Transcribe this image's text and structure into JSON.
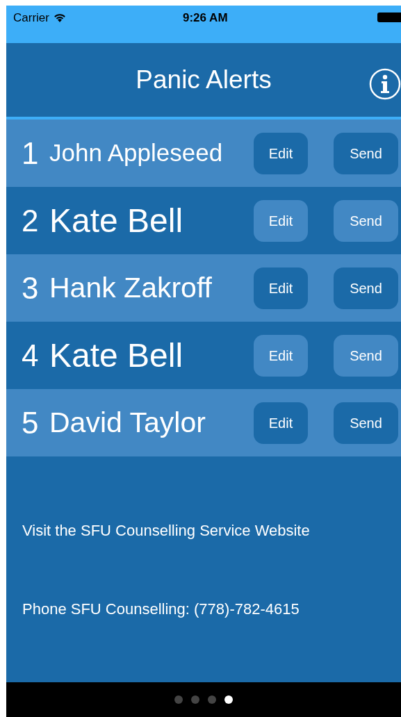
{
  "status_bar": {
    "carrier": "Carrier",
    "time": "9:26 AM"
  },
  "nav_bar": {
    "title": "Panic Alerts"
  },
  "contacts": [
    {
      "number": "1",
      "name": "John Appleseed",
      "edit": "Edit",
      "send": "Send"
    },
    {
      "number": "2",
      "name": "Kate Bell",
      "edit": "Edit",
      "send": "Send"
    },
    {
      "number": "3",
      "name": "Hank Zakroff",
      "edit": "Edit",
      "send": "Send"
    },
    {
      "number": "4",
      "name": "Kate Bell",
      "edit": "Edit",
      "send": "Send"
    },
    {
      "number": "5",
      "name": "David Taylor",
      "edit": "Edit",
      "send": "Send"
    }
  ],
  "links": [
    "Visit the SFU Counselling Service Website",
    "Phone SFU Counselling: (778)-782-4615"
  ],
  "page_indicator": [
    {
      "selected": false
    },
    {
      "selected": false
    },
    {
      "selected": false
    },
    {
      "selected": true
    }
  ]
}
